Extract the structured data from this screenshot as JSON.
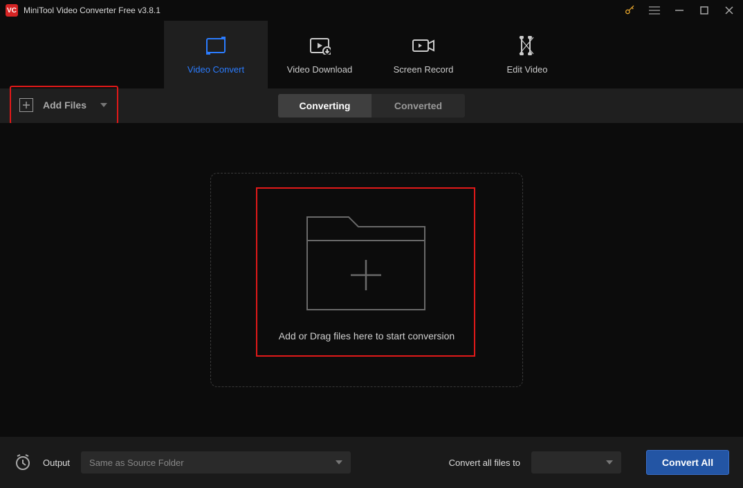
{
  "app": {
    "logo_text": "VC",
    "title": "MiniTool Video Converter Free v3.8.1"
  },
  "main_tabs": [
    {
      "label": "Video Convert",
      "icon": "convert-icon",
      "active": true
    },
    {
      "label": "Video Download",
      "icon": "download-icon",
      "active": false
    },
    {
      "label": "Screen Record",
      "icon": "record-icon",
      "active": false
    },
    {
      "label": "Edit Video",
      "icon": "edit-icon",
      "active": false
    }
  ],
  "toolbar": {
    "add_files_label": "Add Files"
  },
  "sub_tabs": [
    {
      "label": "Converting",
      "active": true
    },
    {
      "label": "Converted",
      "active": false
    }
  ],
  "dropzone": {
    "hint": "Add or Drag files here to start conversion"
  },
  "bottom": {
    "output_label": "Output",
    "output_value": "Same as Source Folder",
    "convert_to_label": "Convert all files to",
    "format_value": "",
    "convert_all_label": "Convert All"
  },
  "colors": {
    "accent": "#2b7cff",
    "highlight": "#e31919",
    "bg": "#0c0c0c",
    "panel": "#1f1f1f"
  }
}
